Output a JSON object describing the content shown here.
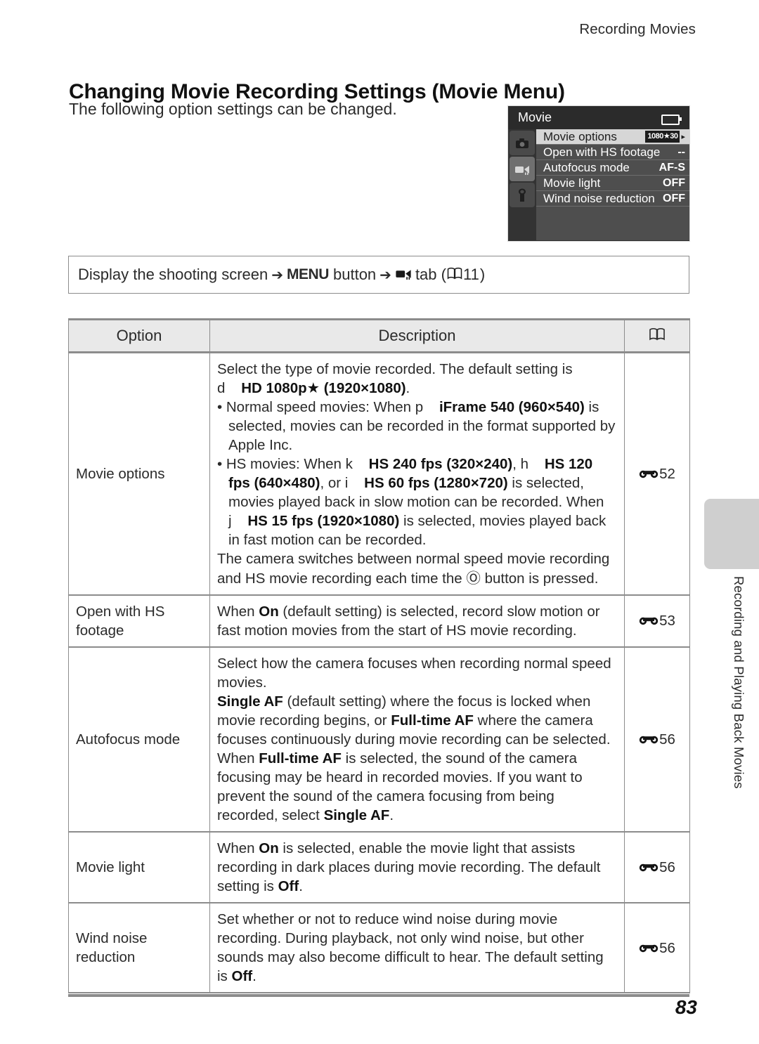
{
  "running_head": "Recording Movies",
  "page_title": "Changing Movie Recording Settings (Movie Menu)",
  "intro": "The following option settings can be changed.",
  "lcd": {
    "title": "Movie",
    "battery_icon": "battery-icon",
    "tabs": [
      {
        "name": "shooting-tab",
        "icon": "camera-icon",
        "selected": false
      },
      {
        "name": "movie-tab",
        "icon": "movie-camera-icon",
        "selected": true
      },
      {
        "name": "setup-tab",
        "icon": "wrench-icon",
        "selected": false
      }
    ],
    "rows": [
      {
        "label": "Movie options",
        "value": "1080★30",
        "badge": true,
        "arrow": "▸",
        "highlighted": true
      },
      {
        "label": "Open with HS footage",
        "value": "--",
        "badge": false,
        "highlighted": false
      },
      {
        "label": "Autofocus mode",
        "value": "AF-S",
        "badge": false,
        "highlighted": false
      },
      {
        "label": "Movie light",
        "value": "OFF",
        "badge": false,
        "highlighted": false
      },
      {
        "label": "Wind noise reduction",
        "value": "OFF",
        "badge": false,
        "highlighted": false
      }
    ]
  },
  "instruction": {
    "part1": "Display the shooting screen",
    "arrow1": "➔",
    "menu_button": "MENU",
    "part2": "button",
    "arrow2": "➔",
    "tab_icon": "movie-camera-icon",
    "part3": "tab",
    "open_paren": "(",
    "book_icon": "book-icon",
    "ref_page": "11",
    "close_paren": ")"
  },
  "table": {
    "headers": {
      "option": "Option",
      "description": "Description",
      "reference": "book-icon"
    },
    "rows": [
      {
        "option": "Movie options",
        "ref": "52",
        "ref_icon": "binocular-icon",
        "desc_blocks": [
          {
            "type": "para",
            "runs": [
              {
                "t": "Select the type of movie recorded. The default setting is ",
                "b": false
              },
              {
                "t": "d",
                "b": false
              },
              {
                "t": "    ",
                "b": false
              },
              {
                "t": "HD 1080p★ (1920×1080)",
                "b": true
              },
              {
                "t": ".",
                "b": false
              }
            ]
          },
          {
            "type": "bullet",
            "runs": [
              {
                "t": "Normal speed movies: When ",
                "b": false
              },
              {
                "t": "p",
                "b": false
              },
              {
                "t": "    ",
                "b": false
              },
              {
                "t": "iFrame 540 (960×540)",
                "b": true
              },
              {
                "t": " is selected, movies can be recorded in the format supported by Apple Inc.",
                "b": false
              }
            ]
          },
          {
            "type": "bullet",
            "runs": [
              {
                "t": "HS movies: When ",
                "b": false
              },
              {
                "t": "k",
                "b": false
              },
              {
                "t": "    ",
                "b": false
              },
              {
                "t": "HS 240 fps (320×240)",
                "b": true
              },
              {
                "t": ", h",
                "b": false
              },
              {
                "t": "    ",
                "b": false
              },
              {
                "t": "HS 120 fps (640×480)",
                "b": true
              },
              {
                "t": ", or i",
                "b": false
              },
              {
                "t": "    ",
                "b": false
              },
              {
                "t": "HS 60 fps (1280×720)",
                "b": true
              },
              {
                "t": " is selected, movies played back in slow motion can be recorded. When j",
                "b": false
              },
              {
                "t": "    ",
                "b": false
              },
              {
                "t": "HS 15 fps (1920×1080)",
                "b": true
              },
              {
                "t": " is selected, movies played back in fast motion can be recorded.",
                "b": false
              }
            ]
          },
          {
            "type": "para",
            "runs": [
              {
                "t": "The camera switches between normal speed movie recording and HS movie recording each time the ",
                "b": false
              },
              {
                "t": "Ⓞ",
                "b": false
              },
              {
                "t": " button is pressed.",
                "b": false
              }
            ]
          }
        ]
      },
      {
        "option": "Open with HS footage",
        "ref": "53",
        "ref_icon": "binocular-icon",
        "desc_blocks": [
          {
            "type": "para",
            "runs": [
              {
                "t": "When ",
                "b": false
              },
              {
                "t": "On",
                "b": true
              },
              {
                "t": " (default setting) is selected, record slow motion or fast motion movies from the start of HS movie recording.",
                "b": false
              }
            ]
          }
        ]
      },
      {
        "option": "Autofocus mode",
        "ref": "56",
        "ref_icon": "binocular-icon",
        "desc_blocks": [
          {
            "type": "para",
            "runs": [
              {
                "t": "Select how the camera focuses when recording normal speed movies.",
                "b": false
              }
            ]
          },
          {
            "type": "para",
            "runs": [
              {
                "t": "Single AF",
                "b": true
              },
              {
                "t": " (default setting) where the focus is locked when movie recording begins, or ",
                "b": false
              },
              {
                "t": "Full-time AF",
                "b": true
              },
              {
                "t": " where the camera focuses continuously during movie recording can be selected. When ",
                "b": false
              },
              {
                "t": "Full-time AF",
                "b": true
              },
              {
                "t": " is selected, the sound of the camera focusing may be heard in recorded movies. If you want to prevent the sound of the camera focusing from being recorded, select ",
                "b": false
              },
              {
                "t": "Single AF",
                "b": true
              },
              {
                "t": ".",
                "b": false
              }
            ]
          }
        ]
      },
      {
        "option": "Movie light",
        "ref": "56",
        "ref_icon": "binocular-icon",
        "desc_blocks": [
          {
            "type": "para",
            "runs": [
              {
                "t": "When ",
                "b": false
              },
              {
                "t": "On",
                "b": true
              },
              {
                "t": " is selected, enable the movie light that assists recording in dark places during movie recording. The default setting is ",
                "b": false
              },
              {
                "t": "Off",
                "b": true
              },
              {
                "t": ".",
                "b": false
              }
            ]
          }
        ]
      },
      {
        "option": "Wind noise reduction",
        "ref": "56",
        "ref_icon": "binocular-icon",
        "desc_blocks": [
          {
            "type": "para",
            "runs": [
              {
                "t": "Set whether or not to reduce wind noise during movie recording. During playback, not only wind noise, but other sounds may also become difficult to hear. The default setting is ",
                "b": false
              },
              {
                "t": "Off",
                "b": true
              },
              {
                "t": ".",
                "b": false
              }
            ]
          }
        ]
      }
    ]
  },
  "side_tab_label": "Recording and Playing Back Movies",
  "page_number": "83"
}
